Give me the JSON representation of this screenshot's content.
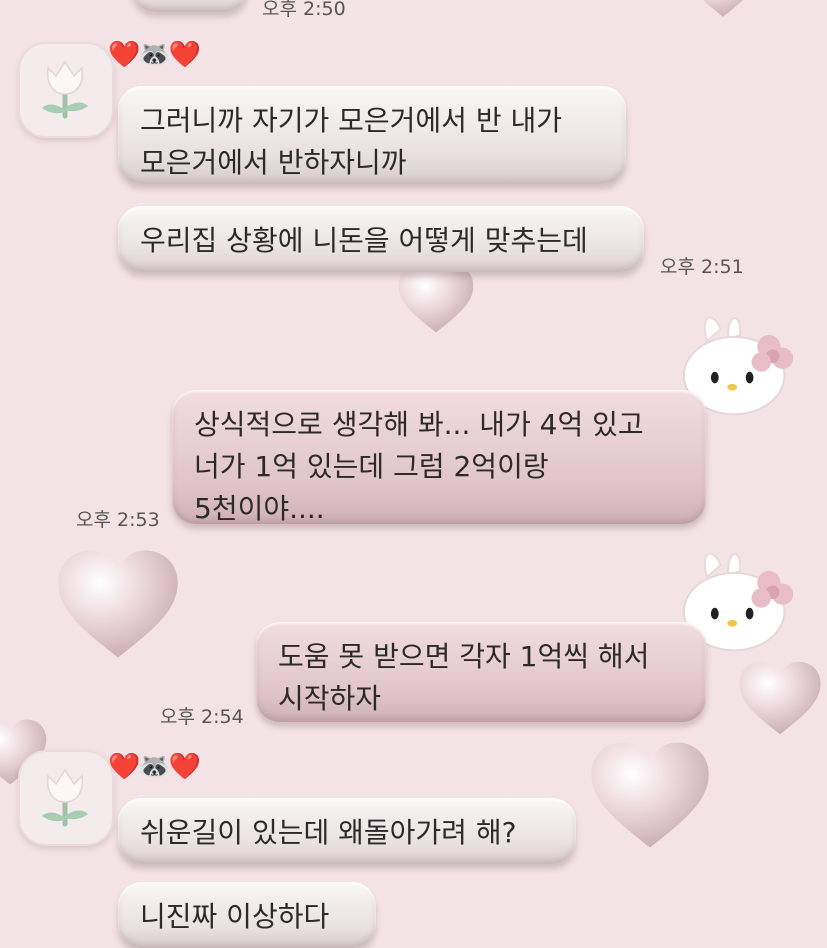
{
  "top": {
    "time": "오후 2:50"
  },
  "msg_group_1": {
    "nickname": "❤️🦝❤️",
    "avatar_icon": "tulip-icon",
    "bubbles": [
      {
        "lines": [
          "그러니까 자기가 모은거에서 반 내가",
          "모은거에서 반하자니까"
        ]
      },
      {
        "lines": [
          "우리집 상황에 니돈을 어떻게 맞추는데"
        ]
      }
    ],
    "time": "오후 2:51"
  },
  "sent_1": {
    "avatar_icon": "hello-kitty-icon",
    "lines": [
      "상식적으로 생각해 봐... 내가 4억 있고",
      "너가 1억 있는데 그럼 2억이랑",
      "5천이야...."
    ],
    "time": "오후 2:53"
  },
  "sent_2": {
    "avatar_icon": "hello-kitty-icon",
    "lines": [
      "도움 못 받으면 각자 1억씩 해서",
      "시작하자"
    ],
    "time": "오후 2:54"
  },
  "msg_group_2": {
    "nickname": "❤️🦝❤️",
    "avatar_icon": "tulip-icon",
    "bubbles": [
      {
        "lines": [
          "쉬운길이 있는데 왜돌아가려 해?"
        ]
      },
      {
        "lines": [
          "니진짜 이상하다"
        ]
      }
    ]
  },
  "colors": {
    "background": "#f3e3e6",
    "incoming_bubble": "#ece5e6",
    "outgoing_bubble": "#e5cdd2",
    "heart": "#e8cfd6"
  }
}
